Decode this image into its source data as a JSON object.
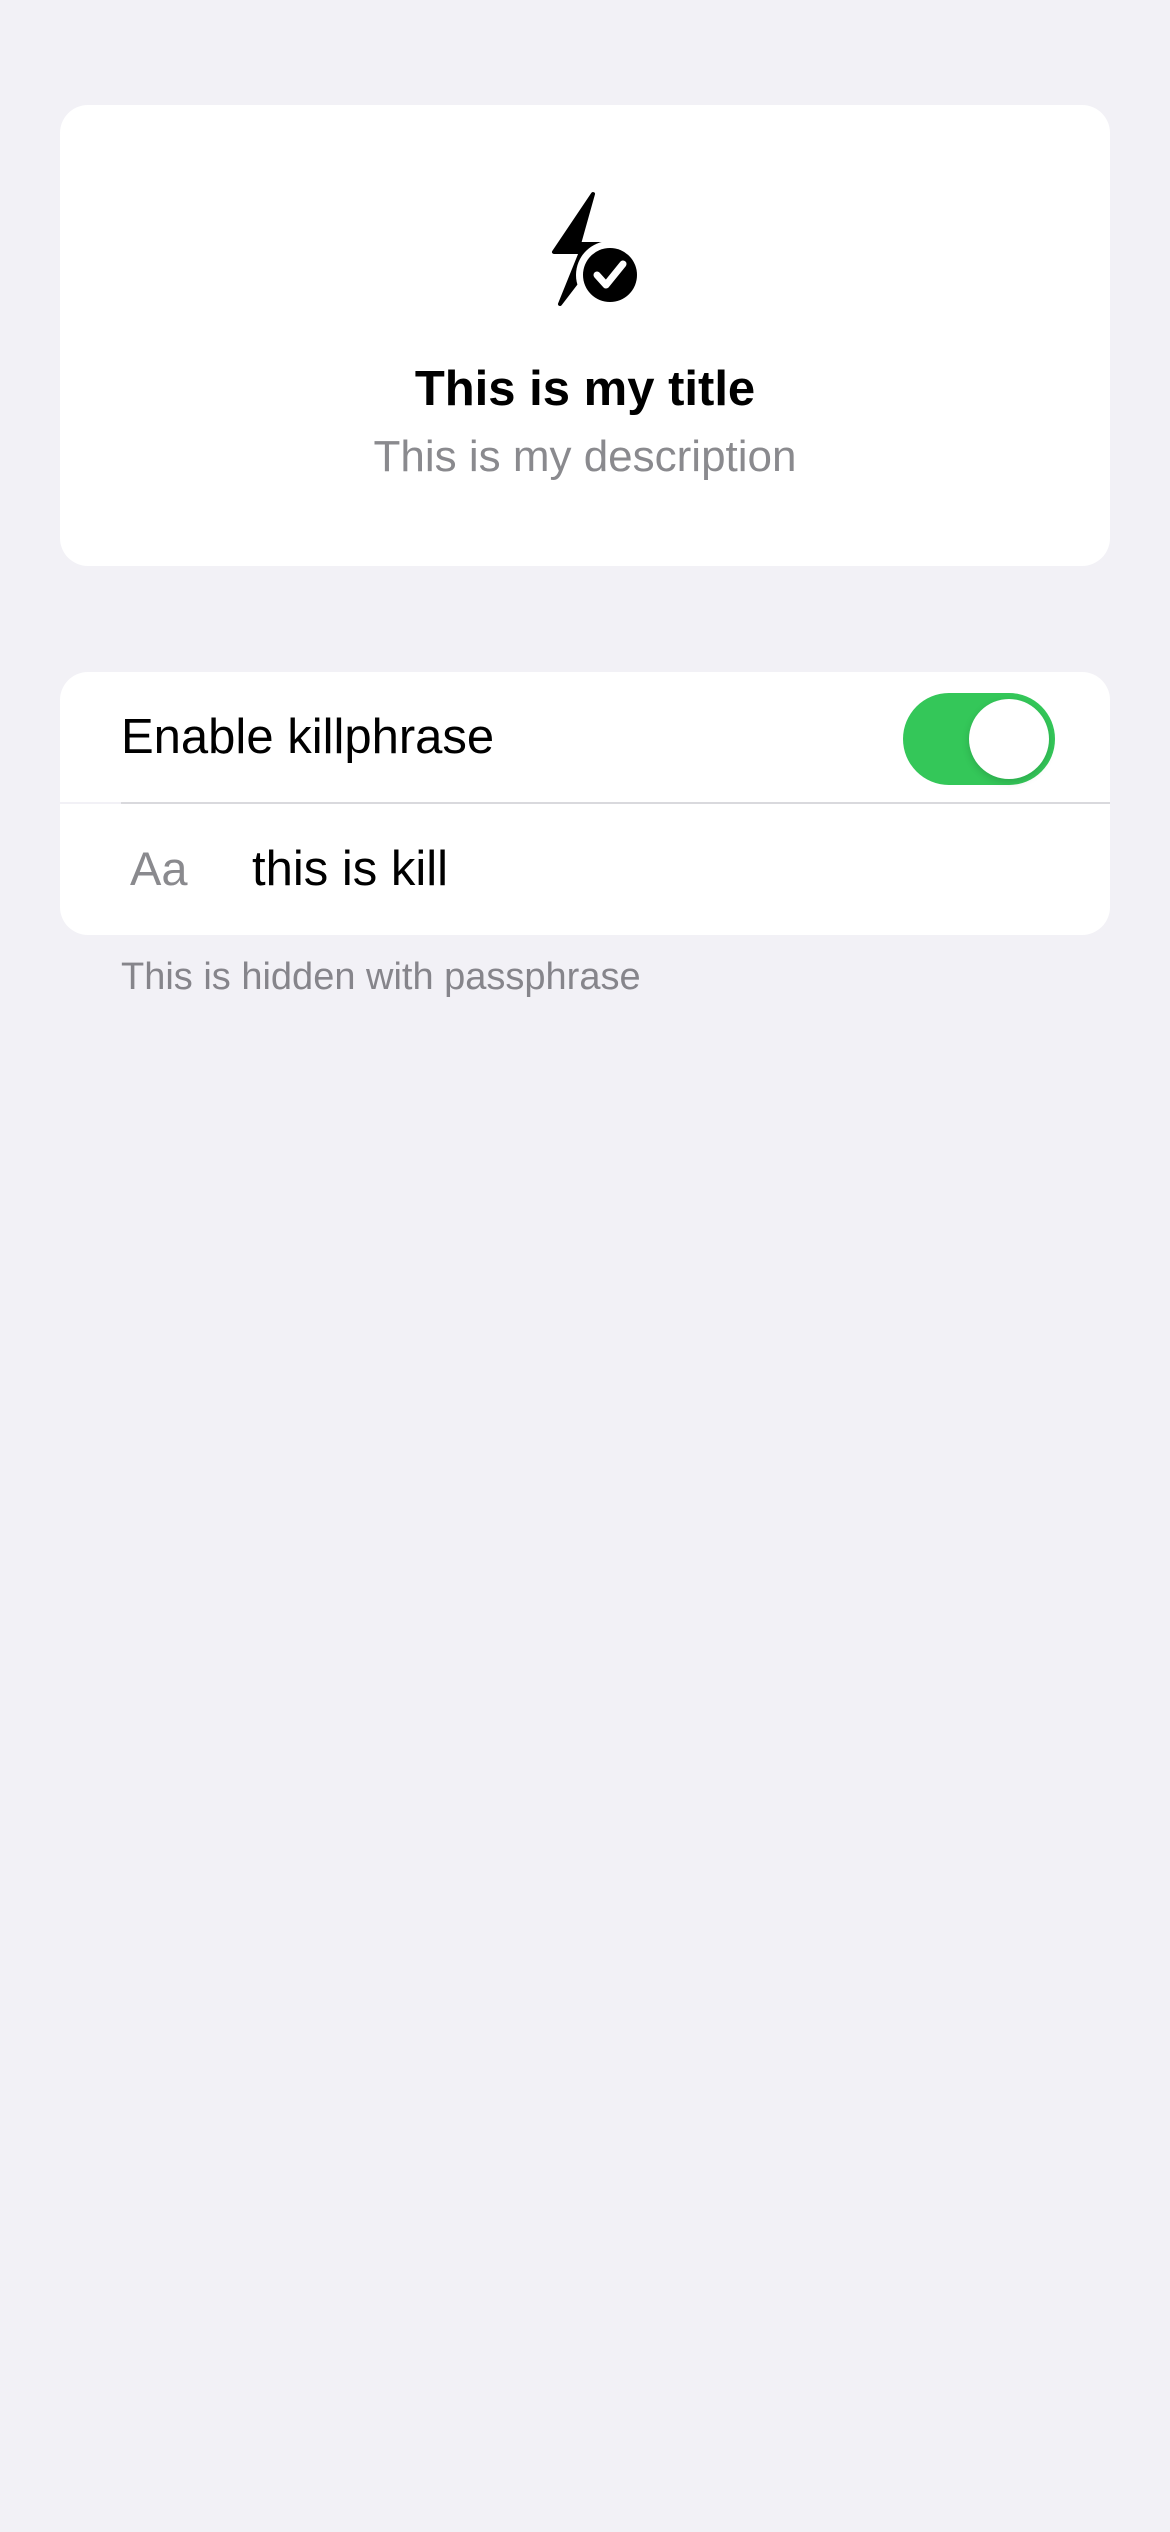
{
  "header": {
    "icon": "bolt-badge-checkmark-icon",
    "title": "This is my title",
    "description": "This is my description"
  },
  "settings": {
    "toggle": {
      "label": "Enable killphrase",
      "on": true,
      "color": "#34c759"
    },
    "phrase": {
      "icon_label": "Aa",
      "value": "this is kill"
    },
    "footer": "This is hidden with passphrase"
  },
  "colors": {
    "background": "#f2f1f6",
    "card": "#ffffff",
    "secondary_text": "#8a8a8e"
  }
}
